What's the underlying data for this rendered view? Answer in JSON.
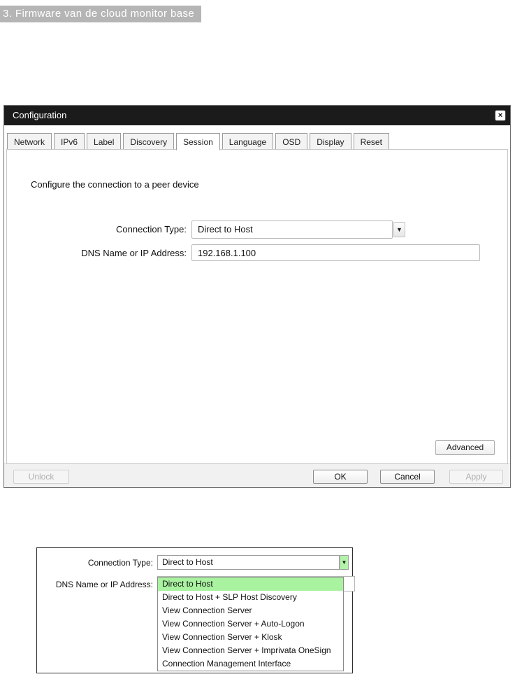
{
  "heading": {
    "text": "3. Firmware van de cloud monitor base"
  },
  "icons": {
    "close": "×",
    "dropdown_arrow": "▼"
  },
  "colors": {
    "highlight_green": "#a9f2a0",
    "title_bar": "#1b1b1b",
    "heading_bg": "#b5b5b5"
  },
  "dialog": {
    "title": "Configuration",
    "tabs": [
      "Network",
      "IPv6",
      "Label",
      "Discovery",
      "Session",
      "Language",
      "OSD",
      "Display",
      "Reset"
    ],
    "active_tab": "Session",
    "session": {
      "description": "Configure the connection to a peer device",
      "connection_type_label": "Connection Type:",
      "connection_type_value": "Direct to Host",
      "dns_label": "DNS Name or IP Address:",
      "dns_value": "192.168.1.100",
      "advanced_button": "Advanced"
    },
    "footer": {
      "unlock": "Unlock",
      "ok": "OK",
      "cancel": "Cancel",
      "apply": "Apply"
    }
  },
  "dropdown_panel": {
    "connection_type_label": "Connection Type:",
    "connection_type_value": "Direct to Host",
    "dns_label": "DNS Name or IP Address:",
    "selected_option": "Direct to Host",
    "options": [
      "Direct to Host",
      "Direct to Host + SLP Host Discovery",
      "View Connection Server",
      "View Connection Server + Auto-Logon",
      "View Connection Server + Klosk",
      "View Connection Server + Imprivata OneSign",
      "Connection Management Interface"
    ]
  }
}
